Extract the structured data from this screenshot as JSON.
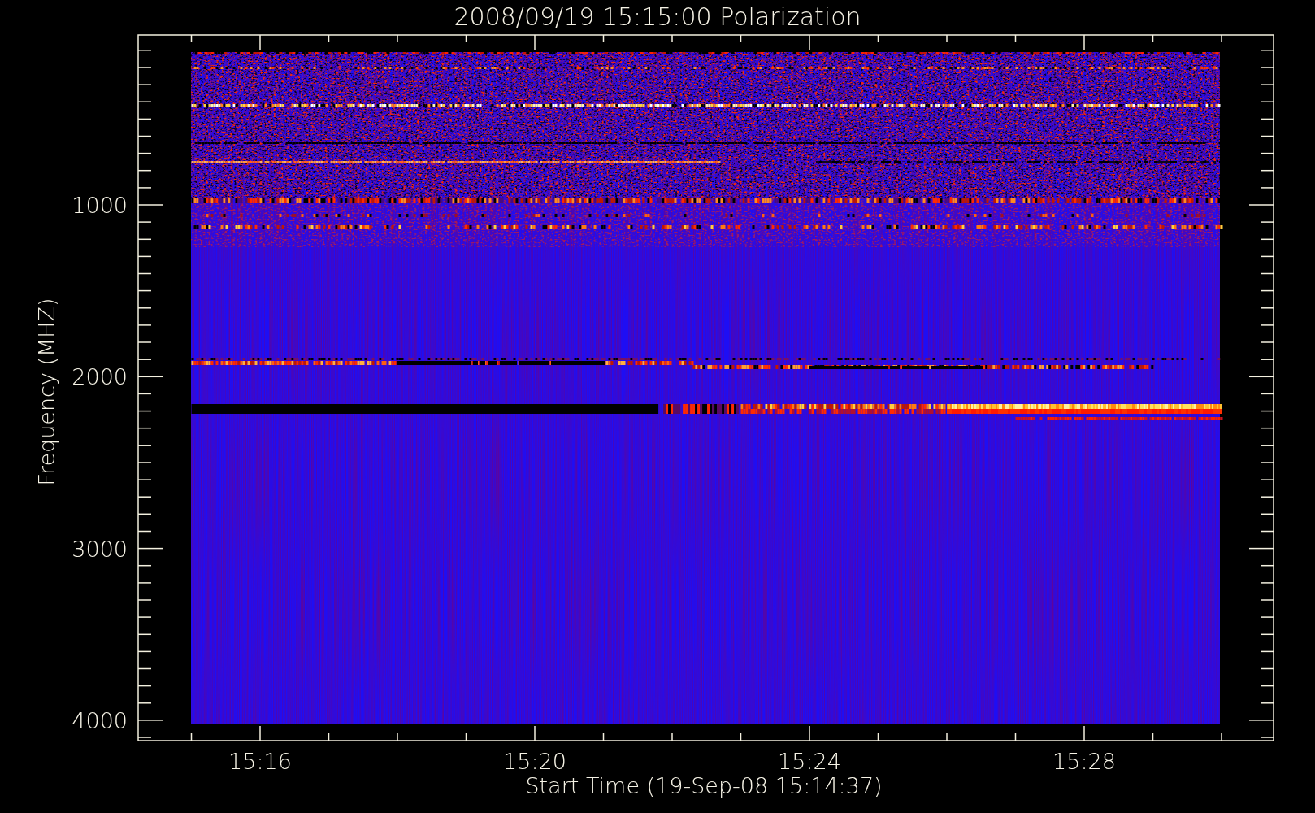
{
  "title": "2008/09/19 15:15:00 Polarization",
  "y_axis": {
    "label": "Frequency (MHZ)",
    "ticks": [
      "1000",
      "2000",
      "3000",
      "4000"
    ]
  },
  "x_axis": {
    "label": "Start Time (19-Sep-08 15:14:37)",
    "ticks": [
      "15:16",
      "15:20",
      "15:24",
      "15:28"
    ]
  }
}
